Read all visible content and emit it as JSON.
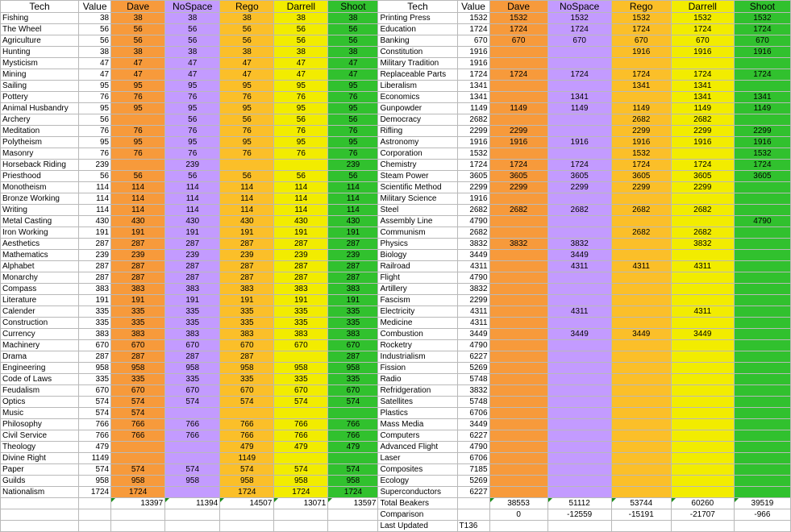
{
  "headers": [
    "Tech",
    "Value",
    "Dave",
    "NoSpace",
    "Rego",
    "Darrell",
    "Shoot",
    "Tech",
    "Value",
    "Dave",
    "NoSpace",
    "Rego",
    "Darrell",
    "Shoot"
  ],
  "colors": {
    "dave": "#f79a3b",
    "nospace": "#c39bff",
    "rego": "#fbbf29",
    "darrell": "#f2ec00",
    "shoot": "#31c12e"
  },
  "left_rows": [
    [
      "Fishing",
      "38",
      "38",
      "38",
      "38",
      "38",
      "38"
    ],
    [
      "The Wheel",
      "56",
      "56",
      "56",
      "56",
      "56",
      "56"
    ],
    [
      "Agriculture",
      "56",
      "56",
      "56",
      "56",
      "56",
      "56"
    ],
    [
      "Hunting",
      "38",
      "38",
      "38",
      "38",
      "38",
      "38"
    ],
    [
      "Mysticism",
      "47",
      "47",
      "47",
      "47",
      "47",
      "47"
    ],
    [
      "Mining",
      "47",
      "47",
      "47",
      "47",
      "47",
      "47"
    ],
    [
      "Sailing",
      "95",
      "95",
      "95",
      "95",
      "95",
      "95"
    ],
    [
      "Pottery",
      "76",
      "76",
      "76",
      "76",
      "76",
      "76"
    ],
    [
      "Animal Husbandry",
      "95",
      "95",
      "95",
      "95",
      "95",
      "95"
    ],
    [
      "Archery",
      "56",
      "",
      "56",
      "56",
      "56",
      "56"
    ],
    [
      "Meditation",
      "76",
      "76",
      "76",
      "76",
      "76",
      "76"
    ],
    [
      "Polytheism",
      "95",
      "95",
      "95",
      "95",
      "95",
      "95"
    ],
    [
      "Masonry",
      "76",
      "76",
      "76",
      "76",
      "76",
      "76"
    ],
    [
      "Horseback Riding",
      "239",
      "",
      "239",
      "",
      "",
      "239"
    ],
    [
      "Priesthood",
      "56",
      "56",
      "56",
      "56",
      "56",
      "56"
    ],
    [
      "Monotheism",
      "114",
      "114",
      "114",
      "114",
      "114",
      "114"
    ],
    [
      "Bronze Working",
      "114",
      "114",
      "114",
      "114",
      "114",
      "114"
    ],
    [
      "Writing",
      "114",
      "114",
      "114",
      "114",
      "114",
      "114"
    ],
    [
      "Metal Casting",
      "430",
      "430",
      "430",
      "430",
      "430",
      "430"
    ],
    [
      "Iron Working",
      "191",
      "191",
      "191",
      "191",
      "191",
      "191"
    ],
    [
      "Aesthetics",
      "287",
      "287",
      "287",
      "287",
      "287",
      "287"
    ],
    [
      "Mathematics",
      "239",
      "239",
      "239",
      "239",
      "239",
      "239"
    ],
    [
      "Alphabet",
      "287",
      "287",
      "287",
      "287",
      "287",
      "287"
    ],
    [
      "Monarchy",
      "287",
      "287",
      "287",
      "287",
      "287",
      "287"
    ],
    [
      "Compass",
      "383",
      "383",
      "383",
      "383",
      "383",
      "383"
    ],
    [
      "Literature",
      "191",
      "191",
      "191",
      "191",
      "191",
      "191"
    ],
    [
      "Calender",
      "335",
      "335",
      "335",
      "335",
      "335",
      "335"
    ],
    [
      "Construction",
      "335",
      "335",
      "335",
      "335",
      "335",
      "335"
    ],
    [
      "Currency",
      "383",
      "383",
      "383",
      "383",
      "383",
      "383"
    ],
    [
      "Machinery",
      "670",
      "670",
      "670",
      "670",
      "670",
      "670"
    ],
    [
      "Drama",
      "287",
      "287",
      "287",
      "287",
      "",
      "287"
    ],
    [
      "Engineering",
      "958",
      "958",
      "958",
      "958",
      "958",
      "958"
    ],
    [
      "Code of Laws",
      "335",
      "335",
      "335",
      "335",
      "335",
      "335"
    ],
    [
      "Feudalism",
      "670",
      "670",
      "670",
      "670",
      "670",
      "670"
    ],
    [
      "Optics",
      "574",
      "574",
      "574",
      "574",
      "574",
      "574"
    ],
    [
      "Music",
      "574",
      "574",
      "",
      "",
      "",
      ""
    ],
    [
      "Philosophy",
      "766",
      "766",
      "766",
      "766",
      "766",
      "766"
    ],
    [
      "Civil Service",
      "766",
      "766",
      "766",
      "766",
      "766",
      "766"
    ],
    [
      "Theology",
      "479",
      "",
      "",
      "479",
      "479",
      "479"
    ],
    [
      "Divine Right",
      "1149",
      "",
      "",
      "1149",
      "",
      ""
    ],
    [
      "Paper",
      "574",
      "574",
      "574",
      "574",
      "574",
      "574"
    ],
    [
      "Guilds",
      "958",
      "958",
      "958",
      "958",
      "958",
      "958"
    ],
    [
      "Nationalism",
      "1724",
      "1724",
      "",
      "1724",
      "1724",
      "1724"
    ]
  ],
  "right_rows": [
    [
      "Printing Press",
      "1532",
      "1532",
      "1532",
      "1532",
      "1532",
      "1532"
    ],
    [
      "Education",
      "1724",
      "1724",
      "1724",
      "1724",
      "1724",
      "1724"
    ],
    [
      "Banking",
      "670",
      "670",
      "670",
      "670",
      "670",
      "670"
    ],
    [
      "Constitution",
      "1916",
      "",
      "",
      "1916",
      "1916",
      "1916"
    ],
    [
      "Military Tradition",
      "1916",
      "",
      "",
      "",
      "",
      ""
    ],
    [
      "Replaceable Parts",
      "1724",
      "1724",
      "1724",
      "1724",
      "1724",
      "1724"
    ],
    [
      "Liberalism",
      "1341",
      "",
      "",
      "1341",
      "1341",
      ""
    ],
    [
      "Economics",
      "1341",
      "",
      "1341",
      "",
      "1341",
      "1341"
    ],
    [
      "Gunpowder",
      "1149",
      "1149",
      "1149",
      "1149",
      "1149",
      "1149"
    ],
    [
      "Democracy",
      "2682",
      "",
      "",
      "2682",
      "2682",
      ""
    ],
    [
      "Rifling",
      "2299",
      "2299",
      "",
      "2299",
      "2299",
      "2299"
    ],
    [
      "Astronomy",
      "1916",
      "1916",
      "1916",
      "1916",
      "1916",
      "1916"
    ],
    [
      "Corporation",
      "1532",
      "",
      "",
      "1532",
      "",
      "1532"
    ],
    [
      "Chemistry",
      "1724",
      "1724",
      "1724",
      "1724",
      "1724",
      "1724"
    ],
    [
      "Steam Power",
      "3605",
      "3605",
      "3605",
      "3605",
      "3605",
      "3605"
    ],
    [
      "Scientific Method",
      "2299",
      "2299",
      "2299",
      "2299",
      "2299",
      ""
    ],
    [
      "Military Science",
      "1916",
      "",
      "",
      "",
      "",
      ""
    ],
    [
      "Steel",
      "2682",
      "2682",
      "2682",
      "2682",
      "2682",
      ""
    ],
    [
      "Assembly Line",
      "4790",
      "",
      "",
      "",
      "",
      "4790"
    ],
    [
      "Communism",
      "2682",
      "",
      "",
      "2682",
      "2682",
      ""
    ],
    [
      "Physics",
      "3832",
      "3832",
      "3832",
      "",
      "3832",
      ""
    ],
    [
      "Biology",
      "3449",
      "",
      "3449",
      "",
      "",
      ""
    ],
    [
      "Railroad",
      "4311",
      "",
      "4311",
      "4311",
      "4311",
      ""
    ],
    [
      "Flight",
      "4790",
      "",
      "",
      "",
      "",
      ""
    ],
    [
      "Artillery",
      "3832",
      "",
      "",
      "",
      "",
      ""
    ],
    [
      "Fascism",
      "2299",
      "",
      "",
      "",
      "",
      ""
    ],
    [
      "Electricity",
      "4311",
      "",
      "4311",
      "",
      "4311",
      ""
    ],
    [
      "Medicine",
      "4311",
      "",
      "",
      "",
      "",
      ""
    ],
    [
      "Combustion",
      "3449",
      "",
      "3449",
      "3449",
      "3449",
      ""
    ],
    [
      "Rocketry",
      "4790",
      "",
      "",
      "",
      "",
      ""
    ],
    [
      "Industrialism",
      "6227",
      "",
      "",
      "",
      "",
      ""
    ],
    [
      "Fission",
      "5269",
      "",
      "",
      "",
      "",
      ""
    ],
    [
      "Radio",
      "5748",
      "",
      "",
      "",
      "",
      ""
    ],
    [
      "Refridgeration",
      "3832",
      "",
      "",
      "",
      "",
      ""
    ],
    [
      "Satellites",
      "5748",
      "",
      "",
      "",
      "",
      ""
    ],
    [
      "Plastics",
      "6706",
      "",
      "",
      "",
      "",
      ""
    ],
    [
      "Mass Media",
      "3449",
      "",
      "",
      "",
      "",
      ""
    ],
    [
      "Computers",
      "6227",
      "",
      "",
      "",
      "",
      ""
    ],
    [
      "Advanced Flight",
      "4790",
      "",
      "",
      "",
      "",
      ""
    ],
    [
      "Laser",
      "6706",
      "",
      "",
      "",
      "",
      ""
    ],
    [
      "Composites",
      "7185",
      "",
      "",
      "",
      "",
      ""
    ],
    [
      "Ecology",
      "5269",
      "",
      "",
      "",
      "",
      ""
    ],
    [
      "Superconductors",
      "6227",
      "",
      "",
      "",
      "",
      ""
    ]
  ],
  "totals_left": [
    "",
    "",
    "13397",
    "11394",
    "14507",
    "13071",
    "13597"
  ],
  "totals_right": {
    "label": "Total Beakers",
    "values": [
      "38553",
      "51112",
      "53744",
      "60260",
      "39519"
    ]
  },
  "comparison": {
    "label": "Comparison",
    "values": [
      "0",
      "-12559",
      "-15191",
      "-21707",
      "-966"
    ]
  },
  "last_updated": {
    "label": "Last Updated",
    "value": "T136"
  }
}
